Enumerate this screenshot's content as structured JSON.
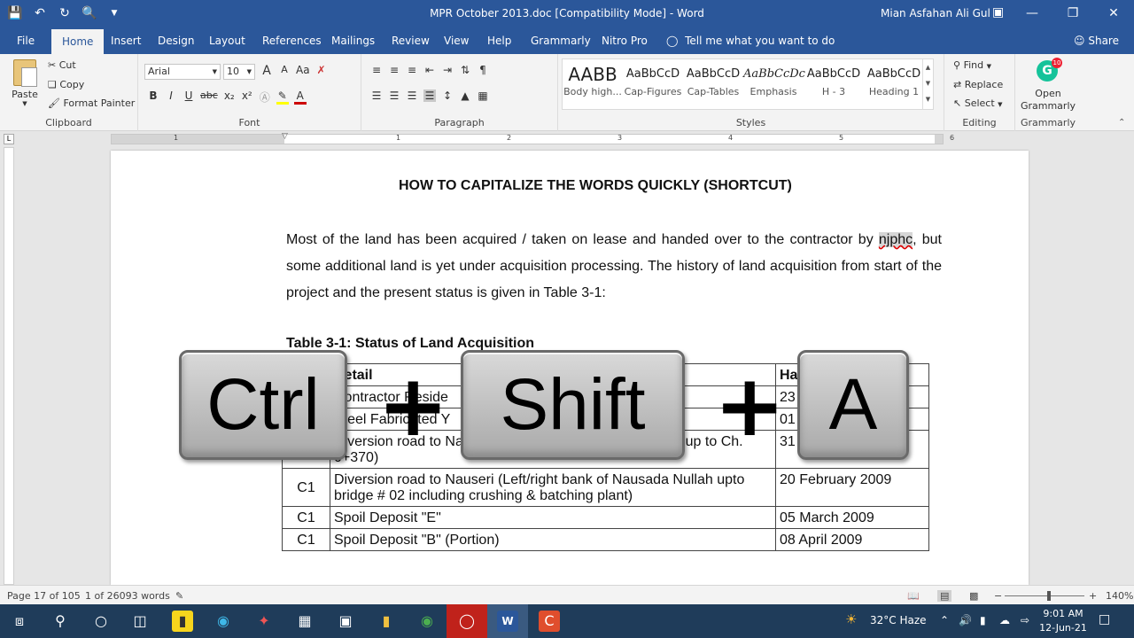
{
  "titlebar": {
    "doc_title": "MPR October 2013.doc [Compatibility Mode]  -  Word",
    "user": "Mian Asfahan Ali Gul",
    "qat_icons": [
      "save-icon",
      "undo-icon",
      "redo-icon",
      "print-preview-icon",
      "customize-icon"
    ]
  },
  "tabs": {
    "items": [
      "File",
      "Home",
      "Insert",
      "Design",
      "Layout",
      "References",
      "Mailings",
      "Review",
      "View",
      "Help",
      "Grammarly",
      "Nitro Pro"
    ],
    "active": "Home",
    "tell_me": "Tell me what you want to do",
    "share": "Share"
  },
  "ribbon": {
    "clipboard": {
      "label": "Clipboard",
      "paste": "Paste",
      "cut": "Cut",
      "copy": "Copy",
      "format_painter": "Format Painter"
    },
    "font": {
      "label": "Font",
      "font_name": "Arial",
      "font_size": "10",
      "bold": "B",
      "italic": "I",
      "underline": "U",
      "strike": "abc",
      "subscript": "x₂",
      "superscript": "x²",
      "grow": "A",
      "shrink": "A",
      "case": "Aa"
    },
    "paragraph": {
      "label": "Paragraph"
    },
    "styles": {
      "label": "Styles",
      "items": [
        {
          "preview": "AABB",
          "name": "Body high..."
        },
        {
          "preview": "AaBbCcD",
          "name": "Cap-Figures"
        },
        {
          "preview": "AaBbCcD",
          "name": "Cap-Tables"
        },
        {
          "preview": "AaBbCcDc",
          "name": "Emphasis"
        },
        {
          "preview": "AaBbCcD",
          "name": "H - 3"
        },
        {
          "preview": "AaBbCcD",
          "name": "Heading 1"
        }
      ]
    },
    "editing": {
      "label": "Editing",
      "find": "Find",
      "replace": "Replace",
      "select": "Select"
    },
    "grammarly": {
      "label": "Grammarly",
      "open1": "Open",
      "open2": "Grammarly",
      "badge": "10",
      "logo": "G"
    }
  },
  "ruler": {
    "numbers": [
      "1",
      "1",
      "2",
      "3",
      "4",
      "5",
      "6"
    ]
  },
  "document": {
    "heading": "HOW TO CAPITALIZE THE WORDS QUICKLY (SHORTCUT)",
    "para_pre": "Most of the land has been acquired / taken on lease and handed over to the contractor by ",
    "para_err": "njphc",
    "para_post": ", but some additional land is yet under acquisition processing. The history of land acquisition from start of the project and the present status is given in Table 3-1:",
    "table_caption": "Table 3-1: Status of Land Acquisition",
    "table": {
      "headers": [
        "",
        "Detail",
        "Ha"
      ],
      "rows": [
        {
          "pkg": "",
          "detail": "Contractor Reside",
          "date": "23"
        },
        {
          "pkg": "",
          "detail": "Steel Fabricated Y",
          "date": "01"
        },
        {
          "pkg": "C1",
          "detail": "Diversion road to Nauseri (Left bank of Nausada Nullah up to Ch. 0+370)",
          "date": "31 July 2008"
        },
        {
          "pkg": "C1",
          "detail": "Diversion road to Nauseri (Left/right bank of Nausada Nullah upto bridge # 02 including crushing & batching plant)",
          "date": "20 February 2009"
        },
        {
          "pkg": "C1",
          "detail": "Spoil Deposit \"E\"",
          "date": "05 March 2009"
        },
        {
          "pkg": "C1",
          "detail": "Spoil Deposit \"B\" (Portion)",
          "date": "08 April 2009"
        }
      ]
    }
  },
  "overlay": {
    "key1": "Ctrl",
    "plus": "+",
    "key2": "Shift",
    "key3": "A"
  },
  "statusbar": {
    "page": "Page 17 of 105",
    "words": "1 of 26093 words",
    "zoom": "140%",
    "zoom_level_pct": 56,
    "minus": "−",
    "plus": "+"
  },
  "taskbar": {
    "weather": "32°C  Haze",
    "time": "9:01 AM",
    "date": "12-Jun-21"
  }
}
